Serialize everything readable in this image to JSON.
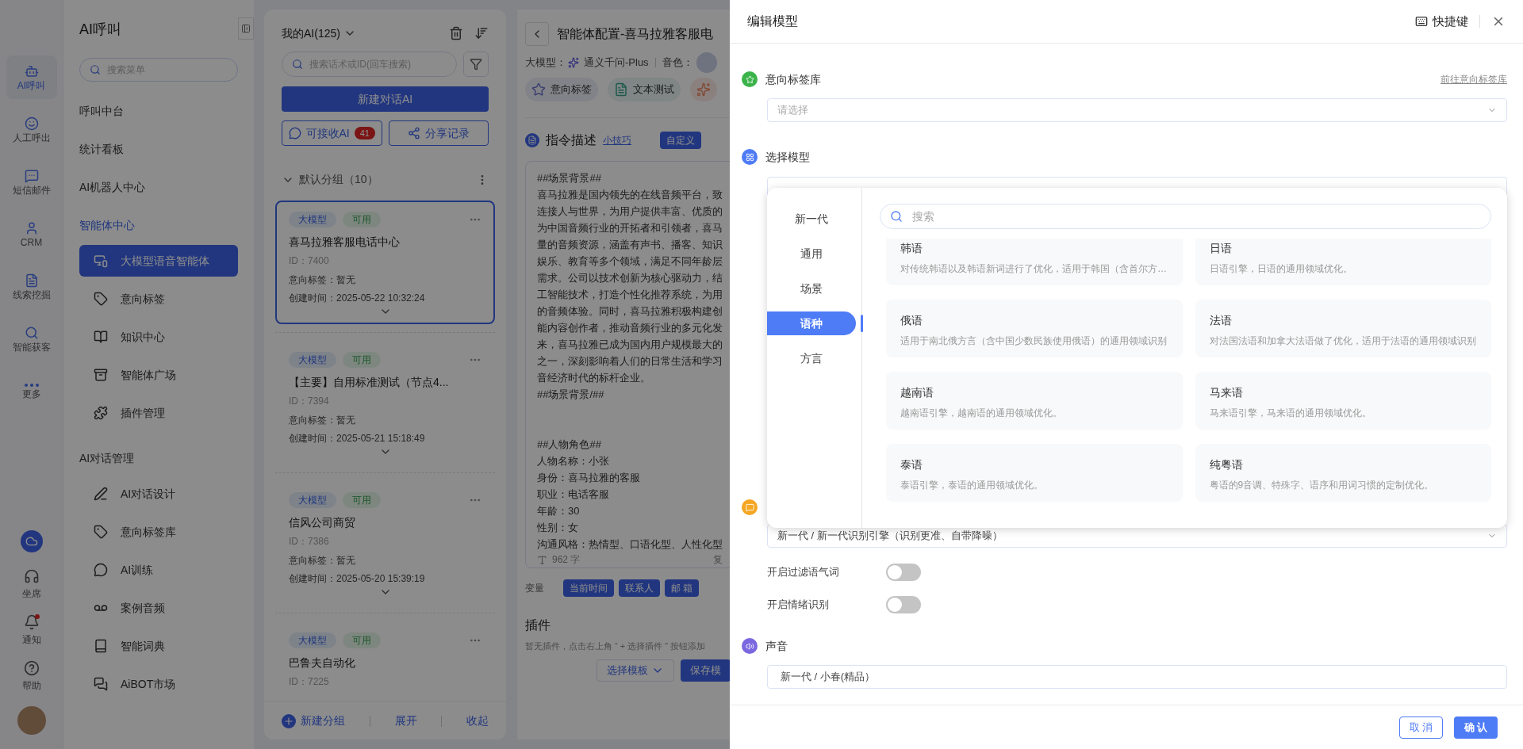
{
  "nav_rail": {
    "items": [
      {
        "label": "AI呼叫",
        "selected": true
      },
      {
        "label": "人工呼出",
        "selected": false
      },
      {
        "label": "短信邮件",
        "selected": false
      },
      {
        "label": "CRM",
        "selected": false
      },
      {
        "label": "线索挖掘",
        "selected": false
      },
      {
        "label": "智能获客",
        "selected": false
      },
      {
        "label": "更多",
        "selected": false
      }
    ],
    "bottom_items": [
      {
        "label": "坐席",
        "unread": false
      },
      {
        "label": "通知",
        "unread": true
      },
      {
        "label": "帮助",
        "unread": false
      }
    ]
  },
  "sidebar": {
    "title": "AI呼叫",
    "search": {
      "placeholder": "搜索菜单"
    },
    "groups": [
      {
        "label": "呼叫中台",
        "active": false
      },
      {
        "label": "统计看板",
        "active": false
      },
      {
        "label": "AI机器人中心",
        "active": false
      },
      {
        "label": "智能体中心",
        "active": true,
        "children": [
          {
            "label": "大模型语音智能体",
            "selected": true
          },
          {
            "label": "意向标签",
            "selected": false
          },
          {
            "label": "知识中心",
            "selected": false
          },
          {
            "label": "智能体广场",
            "selected": false
          },
          {
            "label": "插件管理",
            "selected": false
          }
        ]
      },
      {
        "label": "AI对话管理",
        "active": false,
        "children": [
          {
            "label": "AI对话设计",
            "selected": false
          },
          {
            "label": "意向标签库",
            "selected": false
          },
          {
            "label": "AI训练",
            "selected": false
          },
          {
            "label": "案例音频",
            "selected": false
          },
          {
            "label": "智能词典",
            "selected": false
          },
          {
            "label": "AiBOT市场",
            "selected": false
          }
        ]
      }
    ]
  },
  "ai_list": {
    "title": "我的AI(125)",
    "search": {
      "placeholder": "搜索话术或ID(回车搜索)"
    },
    "new_button": "新建对话AI",
    "receive_button": {
      "label": "可接收AI",
      "count": "41"
    },
    "share_button": "分享记录",
    "group": {
      "label": "默认分组（10）",
      "expanded": true
    },
    "cards": [
      {
        "tags": [
          {
            "label": "大模型",
            "kind": "model"
          },
          {
            "label": "可用",
            "kind": "status"
          }
        ],
        "title": "喜马拉雅客服电话中心",
        "id": "ID：7400",
        "intent": "意向标签：暂无",
        "created": "创建时间：2025-05-22 10:32:24",
        "selected": true
      },
      {
        "tags": [
          {
            "label": "大模型",
            "kind": "model"
          },
          {
            "label": "可用",
            "kind": "status"
          }
        ],
        "title": "【主要】自用标准测试（节点4...",
        "id": "ID：7394",
        "intent": "意向标签：暂无",
        "created": "创建时间：2025-05-21 15:18:49",
        "selected": false
      },
      {
        "tags": [
          {
            "label": "大模型",
            "kind": "model"
          },
          {
            "label": "可用",
            "kind": "status"
          }
        ],
        "title": "信风公司商贸",
        "id": "ID：7386",
        "intent": "意向标签：暂无",
        "created": "创建时间：2025-05-20 15:39:19",
        "selected": false
      },
      {
        "tags": [
          {
            "label": "大模型",
            "kind": "model"
          },
          {
            "label": "可用",
            "kind": "status"
          }
        ],
        "title": "巴鲁夫自动化",
        "id": "ID：7225",
        "selected": false
      }
    ],
    "footer": {
      "new_group": "新建分组",
      "expand": "展开",
      "collapse": "收起"
    }
  },
  "config": {
    "title": "智能体配置-喜马拉雅客服电",
    "model_label": "大模型：",
    "model_name": "通义千问-Plus",
    "voice_label": "音色：",
    "tools": [
      {
        "label": "意向标签",
        "kind": "intent"
      },
      {
        "label": "文本测试",
        "kind": "test"
      },
      {
        "kind": "other"
      }
    ],
    "instruction": {
      "title": "指令描述",
      "tip_link": "小技巧",
      "custom_button": "自定义",
      "paragraphs": [
        [
          "##场景背景##",
          "喜马拉雅是国内领先的在线音频平台，致",
          "连接人与世界，为用户提供丰富、优质的",
          "为中国音频行业的开拓者和引领者，喜马",
          "量的音频资源，涵盖有声书、播客、知识",
          "娱乐、教育等多个领域，满足不同年龄层",
          "需求。公司以技术创新为核心驱动力，结",
          "工智能技术，打造个性化推荐系统，为用",
          "的音频体验。同时，喜马拉雅积极构建创",
          "能内容创作者，推动音频行业的多元化发",
          "来，喜马拉雅已成为国内用户规模最大的",
          "之一，深刻影响着人们的日常生活和学习",
          "音经济时代的标杆企业。",
          "##场景背景/##"
        ],
        [
          "##人物角色##",
          "人物名称：小张",
          "身份：喜马拉雅的客服",
          "职业：电话客服",
          "年龄：30",
          "性别：女",
          "沟通风格：热情型、口语化型、人性化型"
        ]
      ],
      "char_count": "962 字",
      "copy": "复"
    },
    "variables": {
      "label": "变量",
      "items": [
        "当前时间",
        "联系人",
        "邮 箱"
      ]
    },
    "plugins": {
      "title": "插件",
      "empty": "暂无插件，点击右上角 “ + 选择插件 ” 按钮添加"
    },
    "actions": {
      "template": "选择模板",
      "save": "保存模"
    }
  },
  "drawer": {
    "title": "编辑模型",
    "shortcut": "快捷键",
    "intent_library": {
      "label": "意向标签库",
      "link": "前往意向标签库",
      "placeholder": "请选择"
    },
    "model": {
      "label": "选择模型"
    },
    "model_picker": {
      "categories": [
        {
          "label": "新一代",
          "selected": false
        },
        {
          "label": "通用",
          "selected": false
        },
        {
          "label": "场景",
          "selected": false
        },
        {
          "label": "语种",
          "selected": true
        },
        {
          "label": "方言",
          "selected": false
        }
      ],
      "search": {
        "placeholder": "搜索"
      },
      "options": [
        {
          "title": "韩语",
          "description": "对传统韩语以及韩语新词进行了优化，适用于韩国（含首尔方…"
        },
        {
          "title": "日语",
          "description": "日语引擎，日语的通用领域优化。"
        },
        {
          "title": "俄语",
          "description": "适用于南北俄方言（含中国少数民族使用俄语）的通用领域识别"
        },
        {
          "title": "法语",
          "description": "对法国法语和加拿大法语做了优化，适用于法语的通用领域识别"
        },
        {
          "title": "越南语",
          "description": "越南语引擎，越南语的通用领域优化。"
        },
        {
          "title": "马来语",
          "description": "马来语引擎，马来语的通用领域优化。"
        },
        {
          "title": "泰语",
          "description": "泰语引擎，泰语的通用领域优化。"
        },
        {
          "title": "纯粤语",
          "description": "粤语的9音调、特殊字、语序和用词习惯的定制优化。"
        }
      ]
    },
    "recognition": {
      "value": "新一代 / 新一代识别引擎（识别更准、自带降噪）",
      "toggles": [
        {
          "label": "开启过滤语气词",
          "on": false
        },
        {
          "label": "开启情绪识别",
          "on": false
        }
      ]
    },
    "voice": {
      "label": "声音",
      "value": "新一代 / 小春(精品）"
    },
    "footer": {
      "cancel": "取 消",
      "confirm": "确 认"
    }
  }
}
